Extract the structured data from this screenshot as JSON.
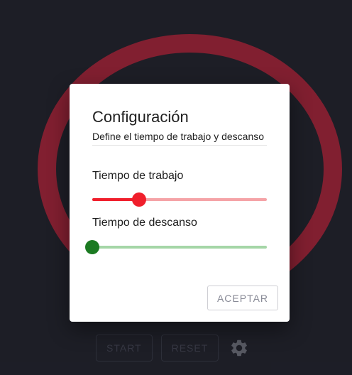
{
  "background": {
    "color": "#1f2029",
    "ring_color": "#882133"
  },
  "controls": {
    "start_label": "START",
    "reset_label": "RESET",
    "settings_icon": "gear-icon"
  },
  "dialog": {
    "title": "Configuración",
    "subtitle": "Define el tiempo de trabajo y descanso",
    "accept_label": "ACEPTAR",
    "sliders": [
      {
        "label": "Tiempo de trabajo",
        "value_fraction": 0.27,
        "active_color": "#f01f2c",
        "rail_color": "#f5a3a7"
      },
      {
        "label": "Tiempo de descanso",
        "value_fraction": 0.0,
        "active_color": "#1b7a22",
        "rail_color": "#a5d6a7"
      }
    ]
  }
}
